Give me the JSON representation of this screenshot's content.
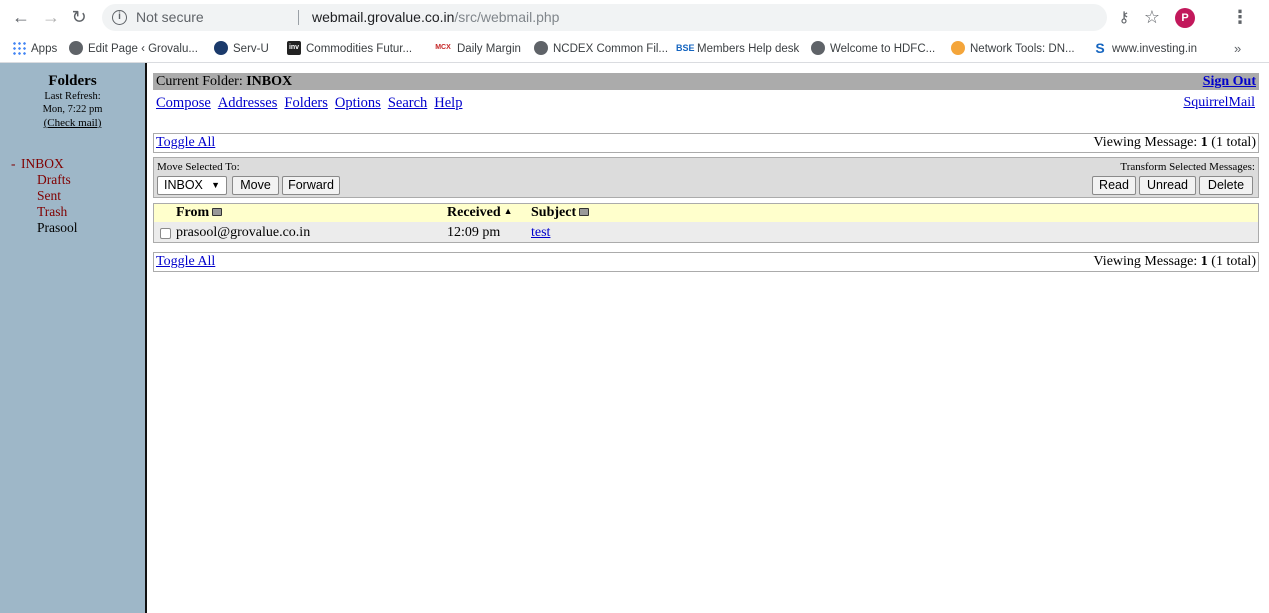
{
  "browser": {
    "omnibox_status": "Not secure",
    "url_host": "webmail.grovalue.co.in",
    "url_path": "/src/webmail.php",
    "profile_initial": "P",
    "bookmarks": [
      {
        "label": "Apps",
        "icon": "apps-grid-icon"
      },
      {
        "label": "Edit Page ‹ Grovalu...",
        "icon": "globe-icon"
      },
      {
        "label": "Serv-U",
        "icon": "servu-icon"
      },
      {
        "label": "Commodities Futur...",
        "icon": "investing-icon"
      },
      {
        "label": "Daily Margin",
        "icon": "mcx-icon"
      },
      {
        "label": "NCDEX Common Fil...",
        "icon": "globe-icon"
      },
      {
        "label": "Members Help desk",
        "icon": "bse-icon"
      },
      {
        "label": "Welcome to HDFC...",
        "icon": "globe-icon"
      },
      {
        "label": "Network Tools: DN...",
        "icon": "network-tools-icon"
      },
      {
        "label": "www.investing.in",
        "icon": "s-icon"
      }
    ],
    "bookmark_icon_text": {
      "inv": "inv",
      "mcx": "MCX",
      "bse": "BSE",
      "s": "S"
    },
    "more_label": "»"
  },
  "left": {
    "title": "Folders",
    "last_refresh_label": "Last Refresh:",
    "last_refresh_time": "Mon, 7:22 pm",
    "check_mail": "(Check mail)",
    "folders": [
      {
        "prefix": "-",
        "name": "INBOX"
      },
      {
        "name": "Drafts"
      },
      {
        "name": "Sent"
      },
      {
        "name": "Trash"
      },
      {
        "name": "Prasool"
      }
    ]
  },
  "main": {
    "current_folder_label": "Current Folder:",
    "current_folder": "INBOX",
    "sign_out": "Sign Out",
    "menu": [
      "Compose",
      "Addresses",
      "Folders",
      "Options",
      "Search",
      "Help"
    ],
    "squirrelmail": "SquirrelMail",
    "toggle_all": "Toggle All",
    "viewing_label": "Viewing Message:",
    "viewing_num": "1",
    "viewing_total": "(1 total)",
    "move_selected_to": "Move Selected To:",
    "transform_selected": "Transform Selected Messages:",
    "move_folder": "INBOX",
    "buttons": {
      "move": "Move",
      "forward": "Forward",
      "read": "Read",
      "unread": "Unread",
      "delete": "Delete"
    },
    "columns": {
      "from": "From",
      "received": "Received",
      "subject": "Subject"
    },
    "messages": [
      {
        "from": "prasool@grovalue.co.in",
        "received": "12:09 pm",
        "subject": "test"
      }
    ]
  },
  "colors": {
    "left_pane": "#9eb7c8",
    "link": "#0000cc",
    "folder": "#800000",
    "header_row": "#ffffcc",
    "folder_bar": "#ababab"
  }
}
